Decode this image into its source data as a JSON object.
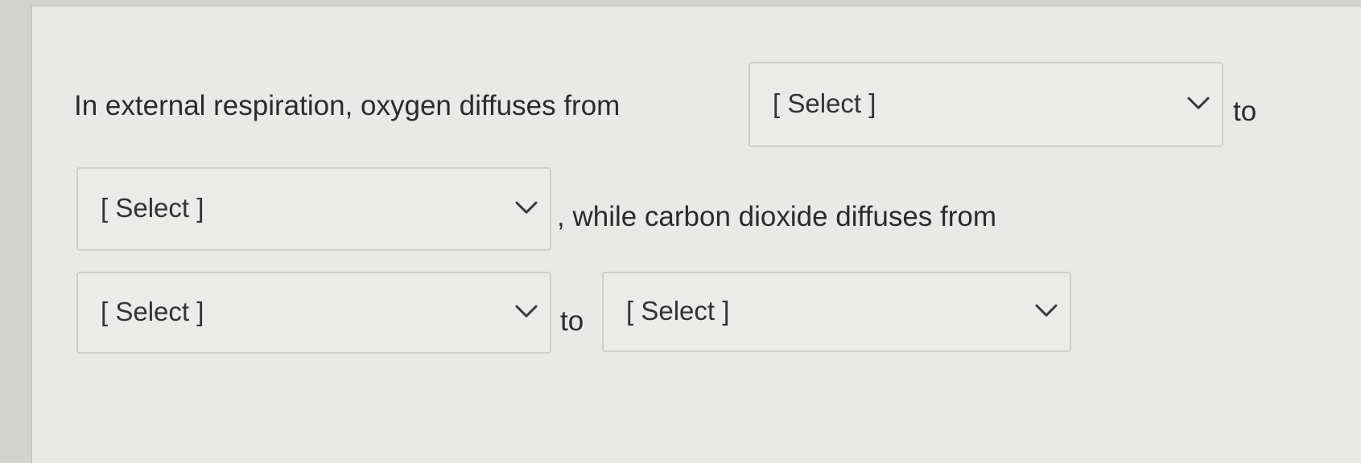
{
  "question": {
    "part1": "In external respiration, oxygen diffuses from",
    "part2": "to",
    "part3": ", while carbon dioxide diffuses from",
    "part4": "to"
  },
  "dropdowns": [
    {
      "selected": "[ Select ]",
      "icon": "chevron-down-icon"
    },
    {
      "selected": "[ Select ]",
      "icon": "chevron-down-icon"
    },
    {
      "selected": "[ Select ]",
      "icon": "chevron-down-icon"
    },
    {
      "selected": "[ Select ]",
      "icon": "chevron-down-icon"
    }
  ]
}
